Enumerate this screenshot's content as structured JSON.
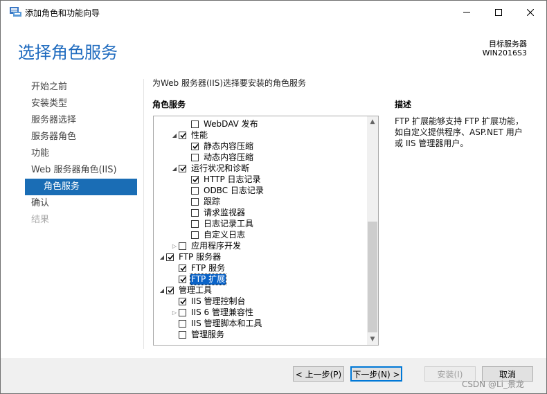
{
  "window": {
    "title": "添加角色和功能向导",
    "minimize_label": "minimize",
    "maximize_label": "maximize",
    "close_label": "close"
  },
  "header": {
    "page_title": "选择角色服务",
    "target_label": "目标服务器",
    "target_server": "WIN2016S3"
  },
  "nav": {
    "items": [
      {
        "label": "开始之前",
        "state": "normal"
      },
      {
        "label": "安装类型",
        "state": "normal"
      },
      {
        "label": "服务器选择",
        "state": "normal"
      },
      {
        "label": "服务器角色",
        "state": "normal"
      },
      {
        "label": "功能",
        "state": "normal"
      },
      {
        "label": "Web 服务器角色(IIS)",
        "state": "normal"
      },
      {
        "label": "角色服务",
        "state": "active"
      },
      {
        "label": "确认",
        "state": "normal"
      },
      {
        "label": "结果",
        "state": "disabled"
      }
    ]
  },
  "main": {
    "instruction": "为Web 服务器(IIS)选择要安装的角色服务",
    "roles_label": "角色服务",
    "description_label": "描述",
    "description_text": "FTP 扩展能够支持 FTP 扩展功能，如自定义提供程序、ASP.NET 用户或 IIS 管理器用户。",
    "tree": [
      {
        "label": "WebDAV 发布",
        "level": 2,
        "expander": "none",
        "checked": false,
        "selected": false
      },
      {
        "label": "性能",
        "level": 1,
        "expander": "expanded",
        "checked": true,
        "selected": false
      },
      {
        "label": "静态内容压缩",
        "level": 2,
        "expander": "none",
        "checked": true,
        "selected": false
      },
      {
        "label": "动态内容压缩",
        "level": 2,
        "expander": "none",
        "checked": false,
        "selected": false
      },
      {
        "label": "运行状况和诊断",
        "level": 1,
        "expander": "expanded",
        "checked": true,
        "selected": false
      },
      {
        "label": "HTTP 日志记录",
        "level": 2,
        "expander": "none",
        "checked": true,
        "selected": false
      },
      {
        "label": "ODBC 日志记录",
        "level": 2,
        "expander": "none",
        "checked": false,
        "selected": false
      },
      {
        "label": "跟踪",
        "level": 2,
        "expander": "none",
        "checked": false,
        "selected": false
      },
      {
        "label": "请求监视器",
        "level": 2,
        "expander": "none",
        "checked": false,
        "selected": false
      },
      {
        "label": "日志记录工具",
        "level": 2,
        "expander": "none",
        "checked": false,
        "selected": false
      },
      {
        "label": "自定义日志",
        "level": 2,
        "expander": "none",
        "checked": false,
        "selected": false
      },
      {
        "label": "应用程序开发",
        "level": 1,
        "expander": "collapsed",
        "checked": false,
        "selected": false
      },
      {
        "label": "FTP 服务器",
        "level": 0,
        "expander": "expanded",
        "checked": true,
        "selected": false
      },
      {
        "label": "FTP 服务",
        "level": 1,
        "expander": "none",
        "checked": true,
        "selected": false
      },
      {
        "label": "FTP 扩展",
        "level": 1,
        "expander": "none",
        "checked": true,
        "selected": true
      },
      {
        "label": "管理工具",
        "level": 0,
        "expander": "expanded",
        "checked": true,
        "selected": false
      },
      {
        "label": "IIS 管理控制台",
        "level": 1,
        "expander": "none",
        "checked": true,
        "selected": false
      },
      {
        "label": "IIS 6 管理兼容性",
        "level": 1,
        "expander": "collapsed",
        "checked": false,
        "selected": false
      },
      {
        "label": "IIS 管理脚本和工具",
        "level": 1,
        "expander": "none",
        "checked": false,
        "selected": false
      },
      {
        "label": "管理服务",
        "level": 1,
        "expander": "none",
        "checked": false,
        "selected": false
      }
    ]
  },
  "footer": {
    "prev_label": "< 上一步(P)",
    "next_label": "下一步(N) >",
    "install_label": "安装(I)",
    "cancel_label": "取消",
    "watermark": "CSDN @Li_景龙"
  },
  "icons": {
    "expanded": "triangle-down-icon",
    "collapsed": "triangle-right-icon",
    "check": "checkmark-icon"
  },
  "colors": {
    "accent": "#1f6bbf",
    "nav_active": "#1a6db5",
    "selection": "#0a63c8"
  }
}
